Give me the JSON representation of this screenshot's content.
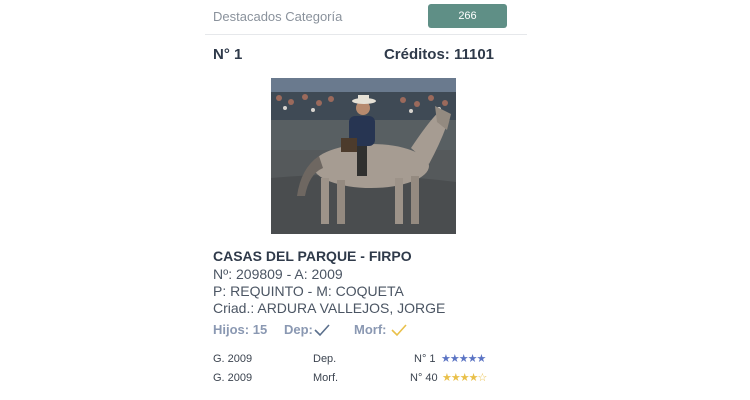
{
  "category": {
    "label": "Destacados Categoría",
    "count": "266"
  },
  "header": {
    "rank": "N° 1",
    "credits": "Créditos: 11101"
  },
  "horse": {
    "name": "CASAS DEL PARQUE - FIRPO",
    "registration": "Nº: 209809 - A: 2009",
    "parents": "P: REQUINTO - M: COQUETA",
    "breeder": "Criad.: ARDURA VALLEJOS, JORGE"
  },
  "meta": {
    "children": "Hijos: 15",
    "dep_label": "Dep:",
    "dep_check_color": "#5a6f8c",
    "morf_label": "Morf:",
    "morf_check_color": "#e9c04a"
  },
  "ratings": [
    {
      "gen": "G. 2009",
      "type": "Dep.",
      "position": "N° 1",
      "stars": 5,
      "star_color": "#5b74c4"
    },
    {
      "gen": "G. 2009",
      "type": "Morf.",
      "position": "N° 40",
      "stars": 4,
      "star_color": "#e9c04a"
    }
  ],
  "colors": {
    "accent": "#5f8f86",
    "title": "#2f3a4a",
    "muted": "#8a98b2"
  }
}
